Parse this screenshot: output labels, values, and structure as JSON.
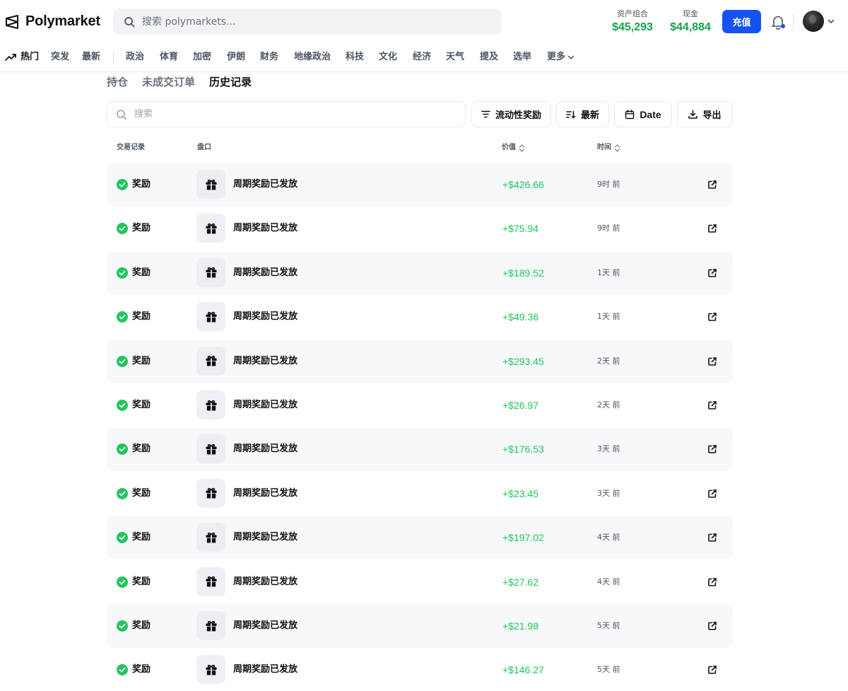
{
  "header": {
    "logo_text": "Polymarket",
    "search_placeholder": "搜索 polymarkets...",
    "portfolio_label": "资产组合",
    "portfolio_value": "$45,293",
    "cash_label": "现金",
    "cash_value": "$44,884",
    "deposit_label": "充值"
  },
  "nav": {
    "items": [
      "热门",
      "突发",
      "最新",
      "政治",
      "体育",
      "加密",
      "伊朗",
      "财务",
      "地缘政治",
      "科技",
      "文化",
      "经济",
      "天气",
      "提及",
      "选举"
    ],
    "more_label": "更多"
  },
  "tabs": [
    "持仓",
    "未成交订单",
    "历史记录"
  ],
  "toolbar": {
    "search_placeholder": "搜索",
    "filter_label": "流动性奖励",
    "sort_label": "最新",
    "date_label": "Date",
    "export_label": "导出"
  },
  "table": {
    "headers": {
      "activity": "交易记录",
      "market": "盘口",
      "value": "价值",
      "time": "时间"
    },
    "rows": [
      {
        "type": "奖励",
        "market": "周期奖励已发放",
        "value": "+$426.66",
        "time": "9时 前"
      },
      {
        "type": "奖励",
        "market": "周期奖励已发放",
        "value": "+$75.94",
        "time": "9时 前"
      },
      {
        "type": "奖励",
        "market": "周期奖励已发放",
        "value": "+$189.52",
        "time": "1天 前"
      },
      {
        "type": "奖励",
        "market": "周期奖励已发放",
        "value": "+$49.36",
        "time": "1天 前"
      },
      {
        "type": "奖励",
        "market": "周期奖励已发放",
        "value": "+$293.45",
        "time": "2天 前"
      },
      {
        "type": "奖励",
        "market": "周期奖励已发放",
        "value": "+$26.97",
        "time": "2天 前"
      },
      {
        "type": "奖励",
        "market": "周期奖励已发放",
        "value": "+$176.53",
        "time": "3天 前"
      },
      {
        "type": "奖励",
        "market": "周期奖励已发放",
        "value": "+$23.45",
        "time": "3天 前"
      },
      {
        "type": "奖励",
        "market": "周期奖励已发放",
        "value": "+$197.02",
        "time": "4天 前"
      },
      {
        "type": "奖励",
        "market": "周期奖励已发放",
        "value": "+$27.62",
        "time": "4天 前"
      },
      {
        "type": "奖励",
        "market": "周期奖励已发放",
        "value": "+$21.98",
        "time": "5天 前"
      },
      {
        "type": "奖励",
        "market": "周期奖励已发放",
        "value": "+$146.27",
        "time": "5天 前"
      }
    ]
  },
  "colors": {
    "accent": "#1652f0",
    "positive": "#22c55e",
    "row_shade": "#f7f8fa"
  }
}
